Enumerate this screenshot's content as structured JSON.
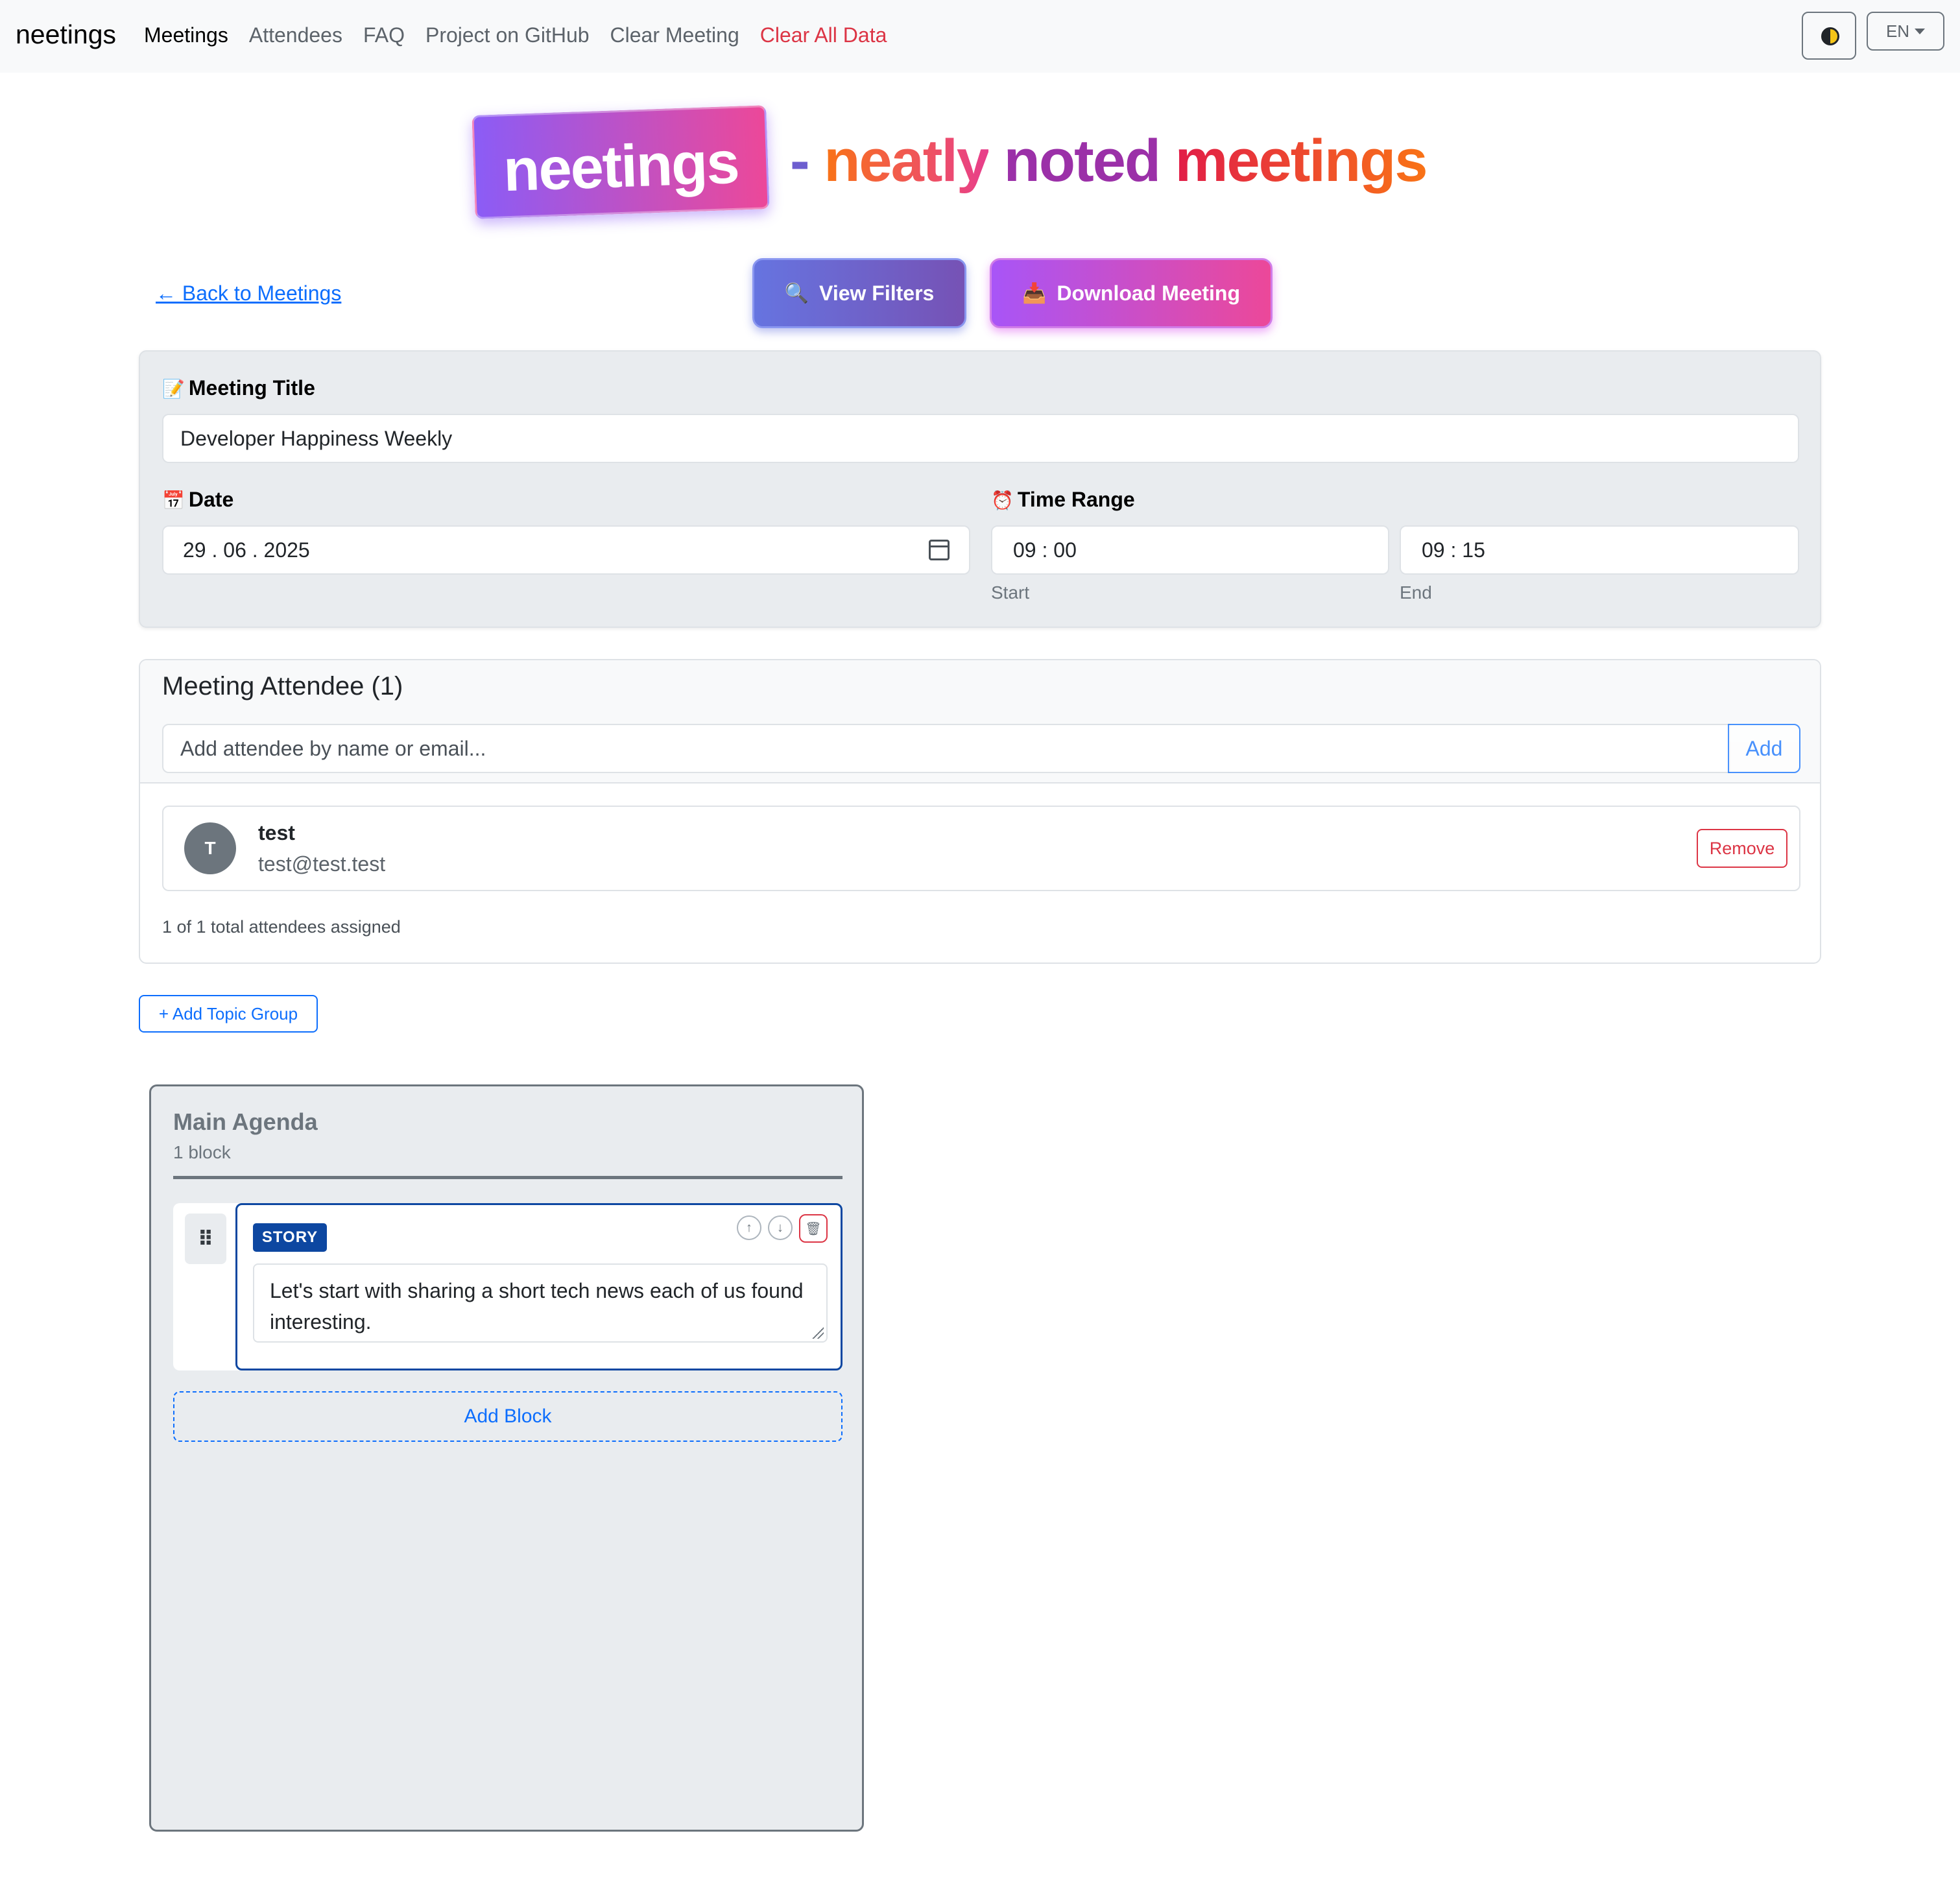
{
  "nav": {
    "brand": "neetings",
    "links": [
      "Meetings",
      "Attendees",
      "FAQ",
      "Project on GitHub",
      "Clear Meeting",
      "Clear All Data"
    ],
    "language": "EN"
  },
  "hero": {
    "logo": "neetings",
    "dash": "-",
    "tagline_words": [
      "neatly",
      "noted",
      "meetings"
    ]
  },
  "actions": {
    "back_link": "← Back to Meetings",
    "view_filters": "View Filters",
    "view_filters_icon": "🔍",
    "download_meeting": "Download Meeting",
    "download_icon": "📥"
  },
  "meeting": {
    "title_label": "Meeting Title",
    "title_icon": "📝",
    "title_value": "Developer Happiness Weekly",
    "date_label": "Date",
    "date_icon": "📅",
    "date_value": "29 . 06 . 2025",
    "time_label": "Time Range",
    "time_icon": "⏰",
    "start_value": "09 : 00",
    "end_value": "09 : 15",
    "start_caption": "Start",
    "end_caption": "End"
  },
  "attendees": {
    "title": "Meeting Attendee (1)",
    "input_placeholder": "Add attendee by name or email...",
    "add_label": "Add",
    "list": [
      {
        "initial": "T",
        "name": "test",
        "email": "test@test.test",
        "remove_label": "Remove"
      }
    ],
    "count_text": "1 of 1 total attendees assigned"
  },
  "add_topic_group": "+ Add Topic Group",
  "agenda": {
    "title": "Main Agenda",
    "subtitle": "1 block",
    "blocks": [
      {
        "type": "STORY",
        "text": "Let's start with sharing a short tech news each of us found interesting."
      }
    ],
    "add_block": "Add Block"
  },
  "colors": {
    "primary": "#0d6efd",
    "danger": "#dc3545",
    "story_badge": "#0d47a1",
    "logo_gradient": [
      "#8b5cf6",
      "#ec4899"
    ]
  }
}
